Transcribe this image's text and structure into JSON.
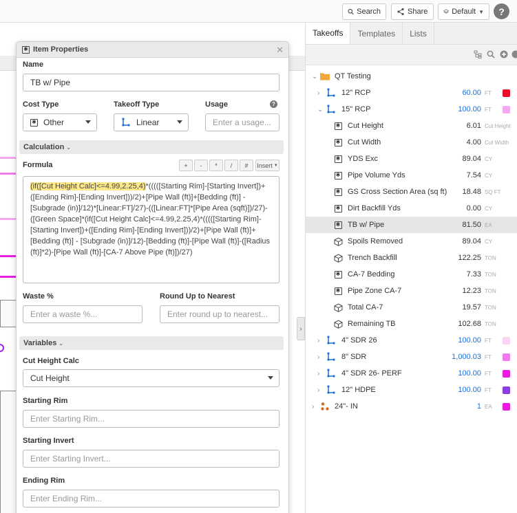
{
  "topbar": {
    "search_label": "Search",
    "share_label": "Share",
    "default_label": "Default",
    "help_label": "?"
  },
  "panel": {
    "title": "Item Properties",
    "name_label": "Name",
    "name_value": "TB w/ Pipe",
    "cost_type_label": "Cost Type",
    "cost_type_value": "Other",
    "takeoff_type_label": "Takeoff Type",
    "takeoff_type_value": "Linear",
    "usage_label": "Usage",
    "usage_placeholder": "Enter a usage...",
    "calculation_label": "Calculation",
    "formula_label": "Formula",
    "ops": [
      "+",
      "-",
      "*",
      "/",
      "#"
    ],
    "insert_label": "Insert",
    "formula_highlight": "(if([Cut Height Calc]<=4.99,2.25,4)",
    "formula_rest": "*(((([Starting Rim]-[Starting Invert])+([Ending Rim]-[Ending Invert]))/2)+[Pipe Wall (ft)]+[Bedding (ft)] - [Subgrade (in)]/12)*[Linear:FT]/27)-(([Linear:FT]*[Pipe Area (sqft)])/27)-([Green Space]*(if([Cut Height Calc]<=4.99,2.25,4)*(((([Starting Rim]-[Starting Invert])+([Ending Rim]-[Ending Invert]))/2)+[Pipe Wall (ft)]+[Bedding (ft)] - [Subgrade (in)]/12)-[Bedding (ft)]-[Pipe Wall (ft)]-([Radius (ft)]*2)-[Pipe Wall (ft)]-[CA-7 Above Pipe (ft)])/27)",
    "waste_label": "Waste %",
    "waste_placeholder": "Enter a waste %...",
    "round_label": "Round Up to Nearest",
    "round_placeholder": "Enter round up to nearest...",
    "variables_label": "Variables",
    "cut_height_calc_label": "Cut Height Calc",
    "cut_height_calc_value": "Cut Height",
    "starting_rim_label": "Starting Rim",
    "starting_rim_placeholder": "Enter Starting Rim...",
    "starting_invert_label": "Starting Invert",
    "starting_invert_placeholder": "Enter Starting Invert...",
    "ending_rim_label": "Ending Rim",
    "ending_rim_placeholder": "Enter Ending Rim..."
  },
  "right": {
    "tabs": [
      "Takeoffs",
      "Templates",
      "Lists"
    ],
    "folder": "QT Testing",
    "rows": [
      {
        "name": "12\" RCP",
        "value": "60.00",
        "unit": "FT",
        "color": "#e8102a",
        "icon": "linear-icon",
        "chev": "right",
        "indent": 1
      },
      {
        "name": "15\" RCP",
        "value": "100.00",
        "unit": "FT",
        "color": "#f3a8ef",
        "icon": "linear-icon",
        "chev": "down",
        "indent": 1
      },
      {
        "name": "Cut Height",
        "value": "6.01",
        "unit": "Cut Height",
        "color": "",
        "icon": "formula-icon",
        "indent": 2
      },
      {
        "name": "Cut Width",
        "value": "4.00",
        "unit": "Cut Width",
        "color": "",
        "icon": "formula-icon",
        "indent": 2
      },
      {
        "name": "YDS Exc",
        "value": "89.04",
        "unit": "CY",
        "color": "",
        "icon": "formula-icon",
        "indent": 2
      },
      {
        "name": "Pipe Volume Yds",
        "value": "7.54",
        "unit": "CY",
        "color": "",
        "icon": "formula-icon",
        "indent": 2
      },
      {
        "name": "GS Cross Section Area (sq ft)",
        "value": "18.48",
        "unit": "SQ FT",
        "color": "",
        "icon": "formula-icon",
        "indent": 2
      },
      {
        "name": "Dirt Backfill Yds",
        "value": "0.00",
        "unit": "CY",
        "color": "",
        "icon": "formula-icon",
        "indent": 2
      },
      {
        "name": "TB w/ Pipe",
        "value": "81.50",
        "unit": "EA",
        "color": "",
        "icon": "formula-icon",
        "indent": 2,
        "selected": true
      },
      {
        "name": "Spoils Removed",
        "value": "89.04",
        "unit": "CY",
        "color": "",
        "icon": "cube-icon",
        "indent": 2
      },
      {
        "name": "Trench Backfill",
        "value": "122.25",
        "unit": "TON",
        "color": "",
        "icon": "cube-icon",
        "indent": 2
      },
      {
        "name": "CA-7 Bedding",
        "value": "7.33",
        "unit": "TON",
        "color": "",
        "icon": "formula-icon",
        "indent": 2
      },
      {
        "name": "Pipe Zone CA-7",
        "value": "12.23",
        "unit": "TON",
        "color": "",
        "icon": "formula-icon",
        "indent": 2
      },
      {
        "name": "Total CA-7",
        "value": "19.57",
        "unit": "TON",
        "color": "",
        "icon": "cube-icon",
        "indent": 2
      },
      {
        "name": "Remaining TB",
        "value": "102.68",
        "unit": "TON",
        "color": "",
        "icon": "cube-icon",
        "indent": 2
      },
      {
        "name": "4\" SDR 26",
        "value": "100.00",
        "unit": "FT",
        "color": "#fbd3f6",
        "icon": "linear-icon",
        "chev": "right",
        "indent": 1
      },
      {
        "name": "8\" SDR",
        "value": "1,000.03",
        "unit": "FT",
        "color": "#f07bea",
        "icon": "linear-icon",
        "chev": "right",
        "indent": 1
      },
      {
        "name": "4\" SDR 26- PERF",
        "value": "100.00",
        "unit": "FT",
        "color": "#e81de0",
        "icon": "linear-icon",
        "chev": "right",
        "indent": 1
      },
      {
        "name": "12\" HDPE",
        "value": "100.00",
        "unit": "FT",
        "color": "#8b3ee0",
        "icon": "linear-icon",
        "chev": "right",
        "indent": 1
      },
      {
        "name": "24\"- IN",
        "value": "1",
        "unit": "EA",
        "color": "#e81de0",
        "icon": "count-icon",
        "chev": "right",
        "indent": 0
      }
    ]
  },
  "colors": {
    "accent": "#1f6fd0",
    "highlight": "#fce78a",
    "folder": "#f0a63a"
  }
}
